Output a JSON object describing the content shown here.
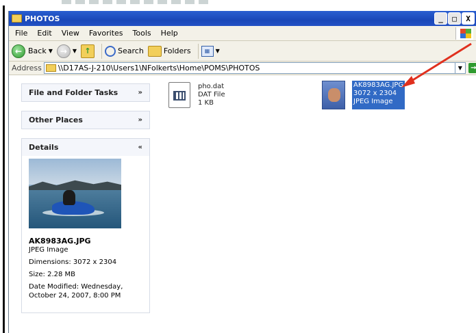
{
  "window": {
    "title": "PHOTOS"
  },
  "controls": {
    "minimize": "_",
    "maximize": "□",
    "close": "X"
  },
  "menubar": {
    "items": [
      "File",
      "Edit",
      "View",
      "Favorites",
      "Tools",
      "Help"
    ]
  },
  "toolbar": {
    "back": "Back",
    "search": "Search",
    "folders": "Folders"
  },
  "address": {
    "label": "Address",
    "path": "\\\\D17AS-J-210\\Users1\\NFolkerts\\Home\\POMS\\PHOTOS",
    "go": "Go"
  },
  "taskpane": {
    "file_folder_tasks": "File and Folder Tasks",
    "other_places": "Other Places",
    "details": {
      "title": "Details",
      "filename": "AK8983AG.JPG",
      "filetype": "JPEG Image",
      "dimensions": "Dimensions: 3072 x 2304",
      "size": "Size: 2.28 MB",
      "modified": "Date Modified: Wednesday, October 24, 2007, 8:00 PM"
    }
  },
  "files": [
    {
      "name": "pho.dat",
      "type": "DAT File",
      "size": "1 KB"
    },
    {
      "name": "AK8983AG.JPG",
      "dims": "3072 x 2304",
      "type": "JPEG Image"
    }
  ],
  "colors": {
    "titlebar": "#1a47b8",
    "selection": "#316ac5",
    "annotation_arrow": "#e0301e"
  }
}
